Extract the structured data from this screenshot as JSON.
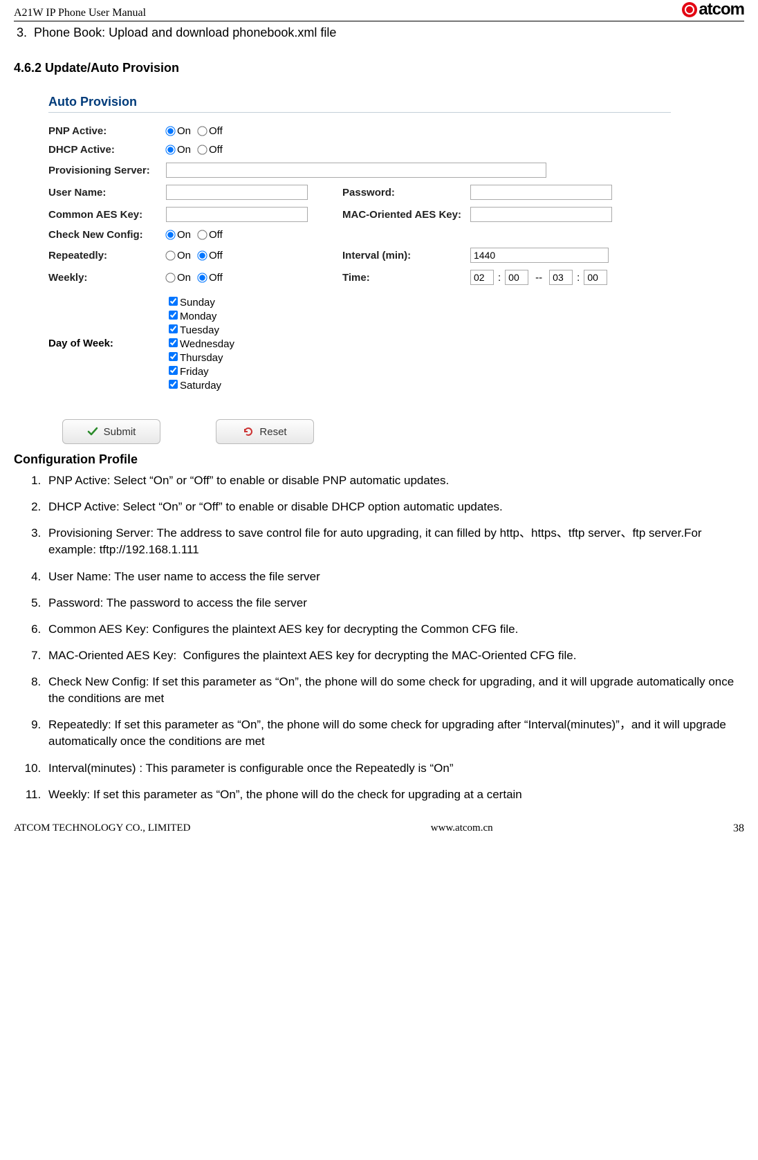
{
  "header": {
    "left": "A21W IP Phone User Manual",
    "logo_text": "atcom"
  },
  "item3": {
    "prefix": "3.",
    "label": "Phone Book:",
    "rest": "Upload and download",
    "tail": "phonebook.xml file"
  },
  "section_heading": "4.6.2 Update/Auto Provision",
  "screenshot": {
    "title": "Auto Provision",
    "on": "On",
    "off": "Off",
    "labels": {
      "pnp": "PNP Active:",
      "dhcp": "DHCP Active:",
      "prov": "Provisioning Server:",
      "user": "User Name:",
      "pass": "Password:",
      "caes": "Common AES Key:",
      "maes": "MAC-Oriented AES Key:",
      "check": "Check New Config:",
      "repeat": "Repeatedly:",
      "interval": "Interval (min):",
      "weekly": "Weekly:",
      "time": "Time:",
      "dow": "Day of Week:"
    },
    "interval_value": "1440",
    "time": {
      "h1": "02",
      "m1": "00",
      "h2": "03",
      "m2": "00"
    },
    "days": [
      "Sunday",
      "Monday",
      "Tuesday",
      "Wednesday",
      "Thursday",
      "Friday",
      "Saturday"
    ],
    "submit": "Submit",
    "reset": "Reset"
  },
  "config_title": "Configuration Profile",
  "list": [
    "PNP Active: Select “On” or “Off” to enable or disable PNP automatic updates.",
    "DHCP Active: Select “On” or “Off” to enable or disable DHCP option automatic updates.",
    "Provisioning Server: The address to save control file for auto upgrading, it can filled by http、https、tftp server、ftp server.For example: tftp://192.168.1.111",
    "User Name: The user name to access the file server",
    "Password: The password to access the file server",
    "Common AES Key: Configures the plaintext AES key for decrypting the Common CFG file.",
    "MAC-Oriented AES Key:  Configures the plaintext AES key for decrypting the MAC-Oriented CFG file.",
    "Check New Config: If set this parameter as “On”, the phone will do some check for upgrading, and it will upgrade automatically once the conditions are met",
    "Repeatedly: If set this parameter as “On”, the phone will do some check for upgrading after “Interval(minutes)”，and it will upgrade automatically once the conditions are met",
    "Interval(minutes) : This parameter is configurable once the Repeatedly is “On”",
    "Weekly: If set this parameter as “On”, the phone will do the check for upgrading at a certain"
  ],
  "footer": {
    "left": "ATCOM TECHNOLOGY CO., LIMITED",
    "center": "www.atcom.cn",
    "right": "38"
  }
}
